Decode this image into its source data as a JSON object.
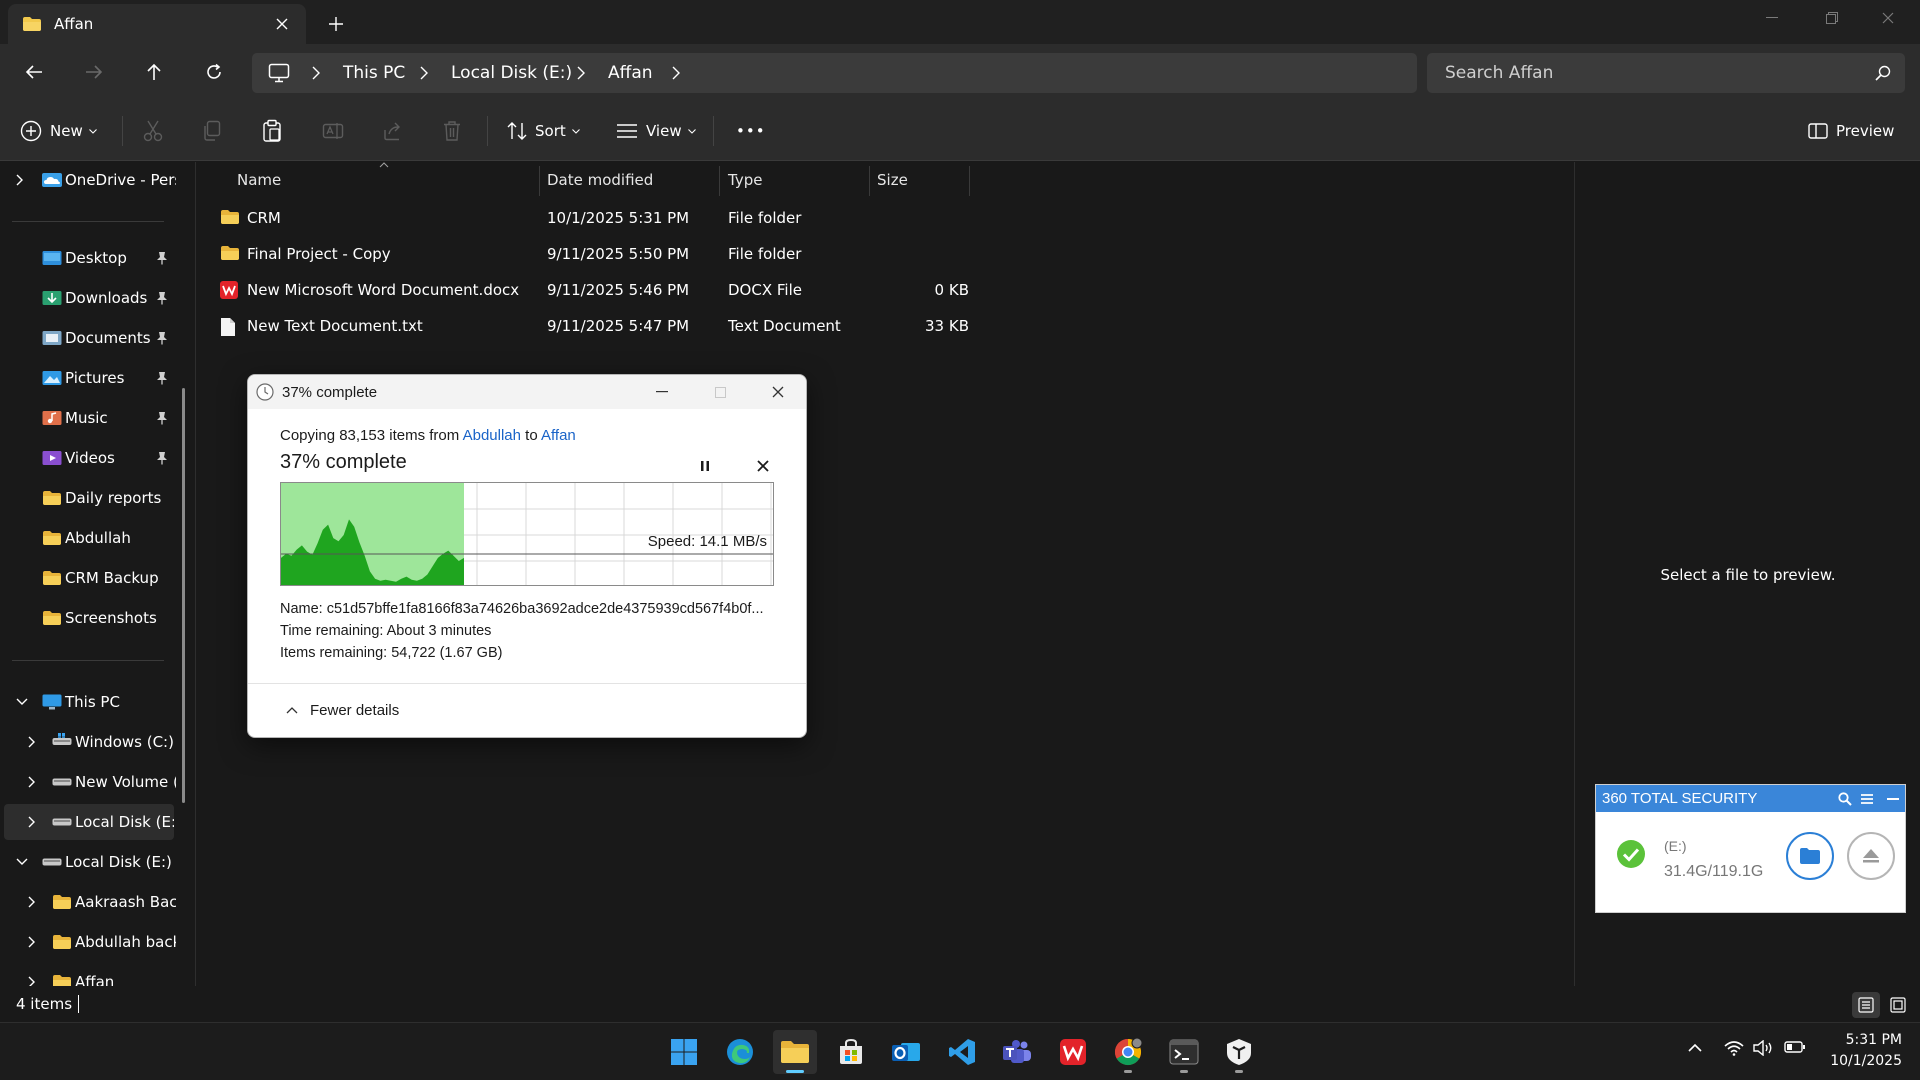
{
  "window": {
    "tab_title": "Affan",
    "colors": {
      "accent": "#60cdff",
      "folder": "#f2c94c",
      "link": "#1a64c8"
    }
  },
  "address": {
    "crumbs": [
      "This PC",
      "Local Disk (E:)",
      "Affan"
    ],
    "search_placeholder": "Search Affan"
  },
  "toolbar": {
    "new_label": "New",
    "sort_label": "Sort",
    "view_label": "View",
    "more_label": "•••",
    "preview_label": "Preview"
  },
  "nav": {
    "onedrive": "OneDrive - Persc",
    "quick": [
      {
        "label": "Desktop",
        "icon": "desktop-icon"
      },
      {
        "label": "Downloads",
        "icon": "downloads-icon"
      },
      {
        "label": "Documents",
        "icon": "documents-icon"
      },
      {
        "label": "Pictures",
        "icon": "pictures-icon"
      },
      {
        "label": "Music",
        "icon": "music-icon"
      },
      {
        "label": "Videos",
        "icon": "videos-icon"
      },
      {
        "label": "Daily reports",
        "icon": "folder-icon"
      },
      {
        "label": "Abdullah",
        "icon": "folder-icon"
      },
      {
        "label": "CRM Backup",
        "icon": "folder-icon"
      },
      {
        "label": "Screenshots",
        "icon": "folder-icon"
      }
    ],
    "this_pc": "This PC",
    "drives": [
      "Windows (C:)",
      "New Volume (D",
      "Local Disk (E:)"
    ],
    "local_disk": "Local Disk (E:)",
    "subfolders": [
      "Aakraash Backu",
      "Abdullah backu",
      "Affan"
    ]
  },
  "list": {
    "columns": [
      "Name",
      "Date modified",
      "Type",
      "Size"
    ],
    "rows": [
      {
        "name": "CRM",
        "date": "10/1/2025 5:31 PM",
        "type": "File folder",
        "size": "",
        "icon": "folder-icon"
      },
      {
        "name": "Final Project - Copy",
        "date": "9/11/2025 5:50 PM",
        "type": "File folder",
        "size": "",
        "icon": "folder-icon"
      },
      {
        "name": "New Microsoft Word Document.docx",
        "date": "9/11/2025 5:46 PM",
        "type": "DOCX File",
        "size": "0 KB",
        "icon": "wps-writer-icon"
      },
      {
        "name": "New Text Document.txt",
        "date": "9/11/2025 5:47 PM",
        "type": "Text Document",
        "size": "33 KB",
        "icon": "text-file-icon"
      }
    ]
  },
  "preview": {
    "empty_text": "Select a file to preview."
  },
  "status": {
    "item_count": "4 items"
  },
  "copy_dialog": {
    "title": "37% complete",
    "copying_prefix": "Copying 83,153 items from ",
    "source": "Abdullah",
    "to_word": " to ",
    "destination": "Affan",
    "percent_text": "37% complete",
    "progress_fraction": 0.37,
    "speed": "Speed: 14.1 MB/s",
    "name_line": "Name:  c51d57bffe1fa8166f83a74626ba3692adce2de4375939cd567f4b0f...",
    "time_line": "Time remaining:  About 3 minutes",
    "items_line": "Items remaining:  54,722 (1.67 GB)",
    "fewer_details": "Fewer details"
  },
  "security_widget": {
    "title": "360 TOTAL SECURITY",
    "drive": "(E:)",
    "capacity": "31.4G/119.1G"
  },
  "taskbar": {
    "apps": [
      "start-icon",
      "edge-icon",
      "file-explorer-icon",
      "store-icon",
      "outlook-icon",
      "vscode-icon",
      "teams-icon",
      "wps-icon",
      "chrome-icon",
      "terminal-icon",
      "app-icon"
    ],
    "time": "5:31 PM",
    "date": "10/1/2025"
  }
}
